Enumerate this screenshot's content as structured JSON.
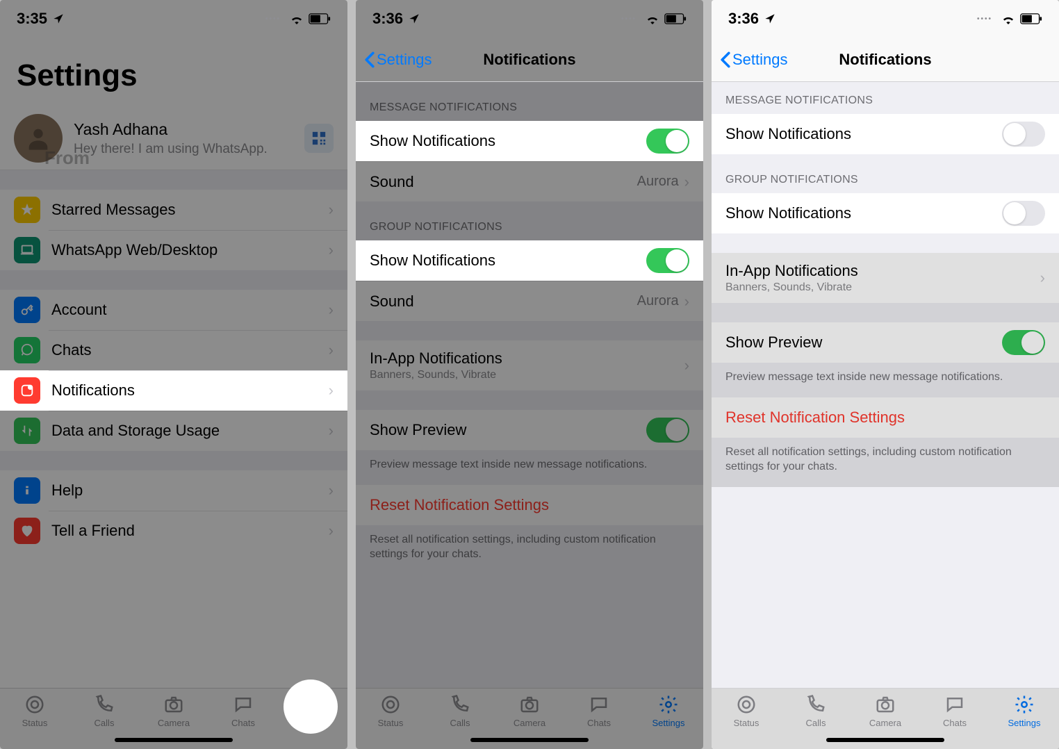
{
  "phones": [
    {
      "time": "3:35",
      "large_title": "Settings",
      "profile": {
        "name": "Yash Adhana",
        "status": "Hey there! I am using WhatsApp."
      },
      "watermark": "From",
      "items": {
        "starred": "Starred Messages",
        "web": "WhatsApp Web/Desktop",
        "account": "Account",
        "chats": "Chats",
        "notifications": "Notifications",
        "data": "Data and Storage Usage",
        "help": "Help",
        "tell": "Tell a Friend"
      }
    },
    {
      "time": "3:36",
      "back": "Settings",
      "title": "Notifications",
      "sections": {
        "msg_header": "MESSAGE NOTIFICATIONS",
        "grp_header": "GROUP NOTIFICATIONS"
      },
      "rows": {
        "show_notifications": "Show Notifications",
        "sound": "Sound",
        "sound_value": "Aurora",
        "inapp": "In-App Notifications",
        "inapp_sub": "Banners, Sounds, Vibrate",
        "preview": "Show Preview",
        "preview_footer": "Preview message text inside new message notifications.",
        "reset": "Reset Notification Settings",
        "reset_footer": "Reset all notification settings, including custom notification settings for your chats."
      }
    },
    {
      "time": "3:36",
      "back": "Settings",
      "title": "Notifications",
      "sections": {
        "msg_header": "MESSAGE NOTIFICATIONS",
        "grp_header": "GROUP NOTIFICATIONS"
      },
      "rows": {
        "show_notifications": "Show Notifications",
        "inapp": "In-App Notifications",
        "inapp_sub": "Banners, Sounds, Vibrate",
        "preview": "Show Preview",
        "preview_footer": "Preview message text inside new message notifications.",
        "reset": "Reset Notification Settings",
        "reset_footer": "Reset all notification settings, including custom notification settings for your chats."
      }
    }
  ],
  "tabs": {
    "status": "Status",
    "calls": "Calls",
    "camera": "Camera",
    "chats": "Chats",
    "settings": "Settings"
  }
}
